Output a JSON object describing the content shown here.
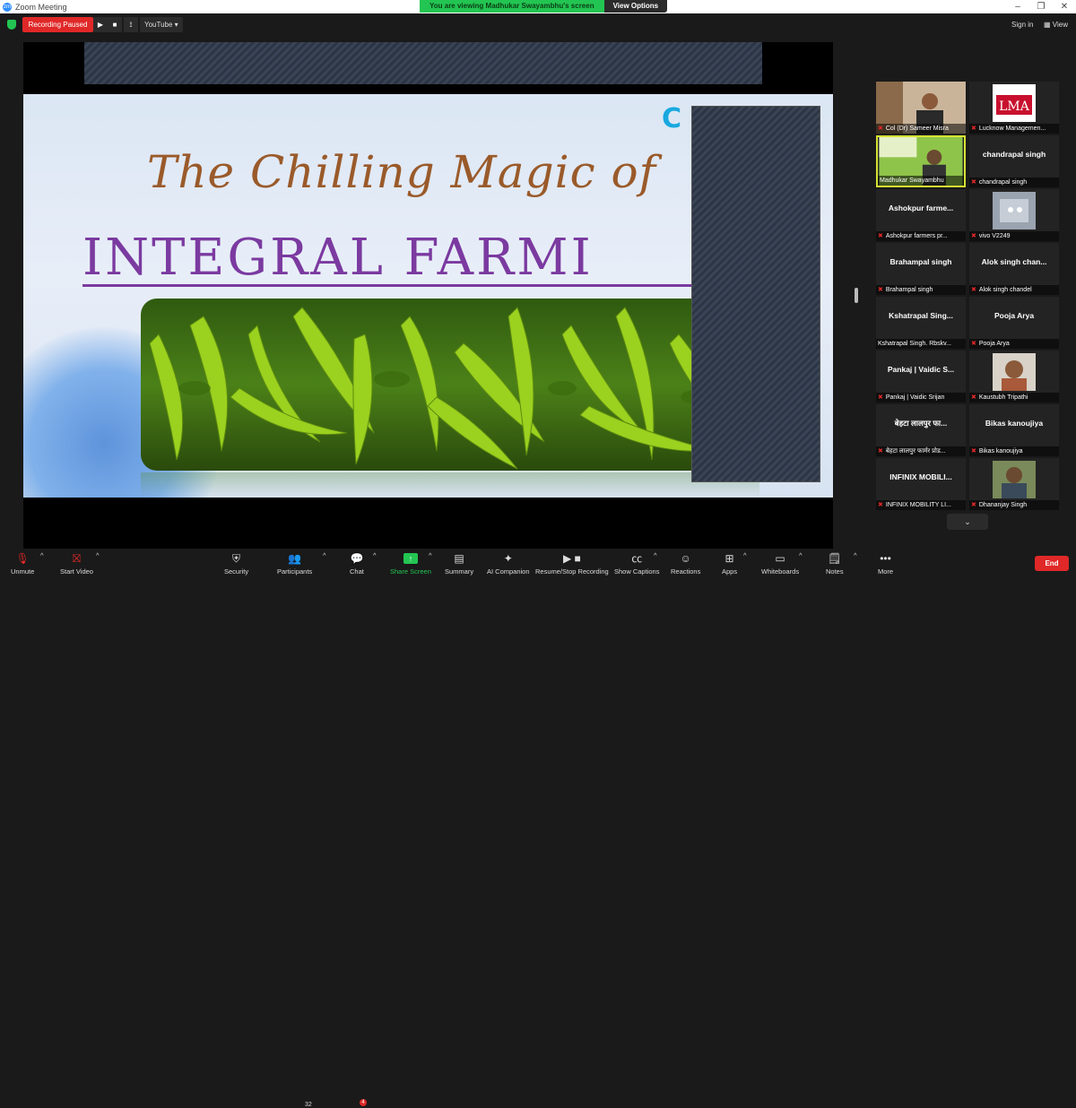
{
  "window": {
    "title": "Zoom Meeting"
  },
  "banner": {
    "message": "You are viewing Madhukar Swayambhu's screen",
    "options_label": "View Options"
  },
  "topbar": {
    "recording_label": "Recording Paused",
    "play_symbol": "▶",
    "stop_symbol": "■",
    "stream_label": "YouTube",
    "sign_in": "Sign in",
    "view": "View"
  },
  "slide": {
    "logo": "C",
    "title_line1": "The Chilling Magic of",
    "title_line2": "INTEGRAL FARMI"
  },
  "participants": [
    {
      "name": "",
      "label": "Col (Dr) Sameer Misra",
      "type": "video",
      "muted": true
    },
    {
      "name": "",
      "label": "Lucknow Managemen...",
      "type": "logo",
      "logo_text": "LMA",
      "muted": true
    },
    {
      "name": "",
      "label": "Madhukar Swayambhu",
      "type": "video",
      "muted": false,
      "active": true
    },
    {
      "name": "chandrapal singh",
      "label": "chandrapal singh",
      "type": "name",
      "muted": true
    },
    {
      "name": "Ashokpur  farme...",
      "label": "Ashokpur farmers pr...",
      "type": "name",
      "muted": true
    },
    {
      "name": "",
      "label": "vivo V2249",
      "type": "video",
      "muted": true
    },
    {
      "name": "Brahampal singh",
      "label": "Brahampal singh",
      "type": "name",
      "muted": true
    },
    {
      "name": "Alok singh  chan...",
      "label": "Alok singh chandel",
      "type": "name",
      "muted": true
    },
    {
      "name": "Kshatrapal  Sing...",
      "label": "Kshatrapal Singh. Rbskv...",
      "type": "name",
      "muted": false
    },
    {
      "name": "Pooja Arya",
      "label": "Pooja Arya",
      "type": "name",
      "muted": true
    },
    {
      "name": "Pankaj | Vaidic S...",
      "label": "Pankaj | Vaidic Srijan",
      "type": "name",
      "muted": true
    },
    {
      "name": "",
      "label": "Kaustubh Tripathi",
      "type": "video",
      "muted": true
    },
    {
      "name": "बेहटा लालपुर फा...",
      "label": "बेहटा लालपुर फार्मर प्रोड...",
      "type": "name",
      "muted": true
    },
    {
      "name": "Bikas kanoujiya",
      "label": "Bikas kanoujiya",
      "type": "name",
      "muted": true
    },
    {
      "name": "INFINIX MOBILI...",
      "label": "INFINIX MOBILITY LI...",
      "type": "name",
      "muted": true
    },
    {
      "name": "",
      "label": "Dhananjay Singh",
      "type": "video",
      "muted": true
    }
  ],
  "toolbar": {
    "unmute": "Unmute",
    "start_video": "Start Video",
    "security": "Security",
    "participants": "Participants",
    "participants_count": "32",
    "chat": "Chat",
    "chat_badge": "4",
    "share_screen": "Share Screen",
    "summary": "Summary",
    "ai_companion": "AI Companion",
    "resume_recording": "Resume/Stop Recording",
    "show_captions": "Show Captions",
    "reactions": "Reactions",
    "apps": "Apps",
    "whiteboards": "Whiteboards",
    "notes": "Notes",
    "more": "More",
    "end": "End"
  },
  "colors": {
    "accent_green": "#23c552",
    "record_red": "#e02828",
    "active_tile": "#d6e232"
  }
}
